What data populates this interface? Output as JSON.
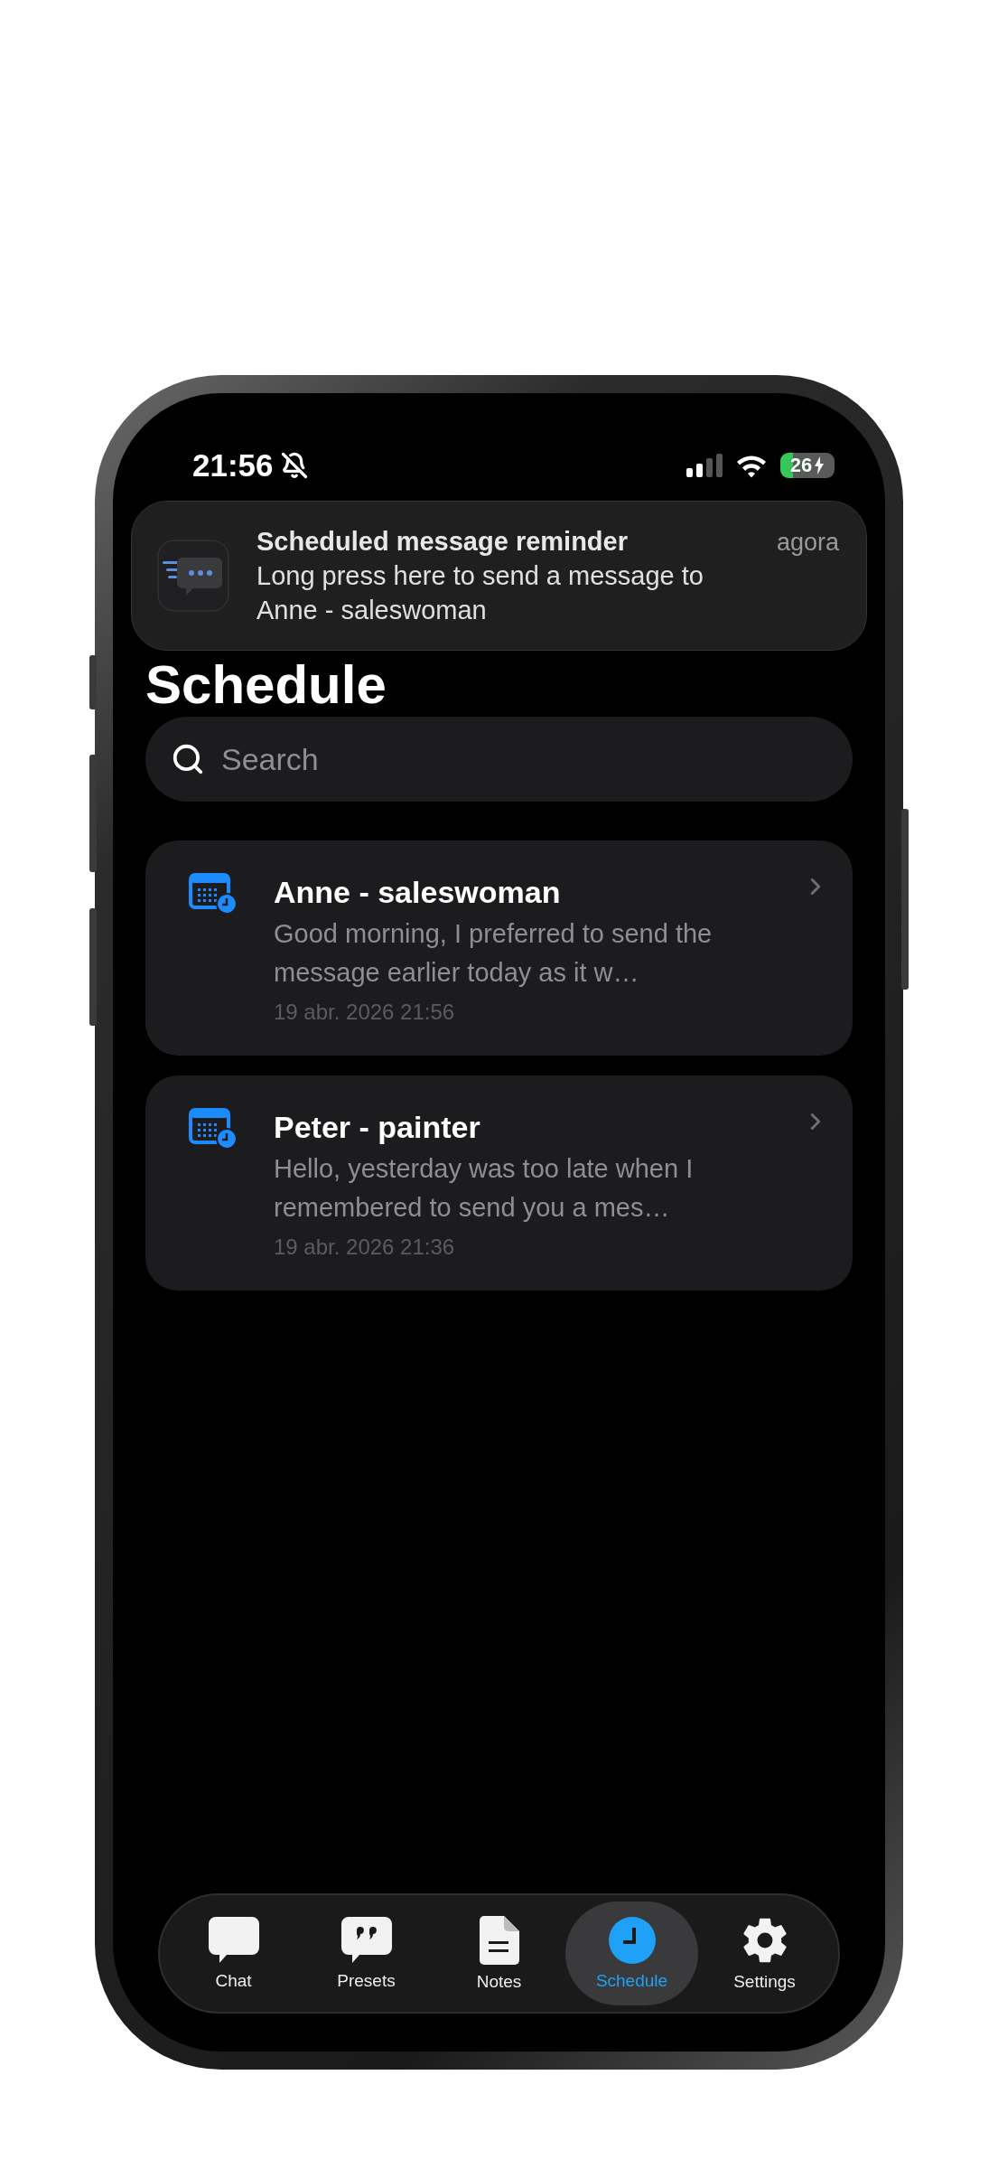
{
  "status_bar": {
    "time": "21:56",
    "muted": true,
    "battery": "26"
  },
  "notification": {
    "title": "Scheduled message reminder",
    "time": "agora",
    "body": "Long press here to send a message to Anne - saleswoman"
  },
  "title": "Schedule",
  "search": {
    "placeholder": "Search"
  },
  "schedules": [
    {
      "name": "Anne - saleswoman",
      "preview": "Good morning, I preferred to send the message earlier today as it w…",
      "date": "19 abr. 2026 21:56"
    },
    {
      "name": "Peter - painter",
      "preview": "Hello, yesterday was too late when I remembered to send you a mes…",
      "date": "19 abr. 2026 21:36"
    }
  ],
  "tabs": [
    {
      "kind": "chat",
      "label": "Chat",
      "selected": false
    },
    {
      "kind": "presets",
      "label": "Presets",
      "selected": false
    },
    {
      "kind": "notes",
      "label": "Notes",
      "selected": false
    },
    {
      "kind": "schedule",
      "label": "Schedule",
      "selected": true
    },
    {
      "kind": "settings",
      "label": "Settings",
      "selected": false
    }
  ]
}
